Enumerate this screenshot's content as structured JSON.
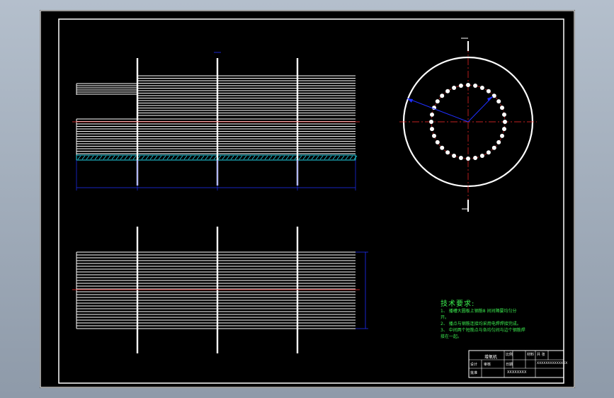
{
  "drawing": {
    "colors": {
      "frame": "#ffffff",
      "centerline": "#ff2a2a",
      "dimension": "#1f2fff",
      "hatch": "#22d4e8",
      "notes": "#3cf050"
    },
    "icons": [
      "section-arrow-icon"
    ]
  },
  "notes": {
    "title": "技术要求:",
    "lines": [
      "1、 播槽大圆板上钢筋8  间间隔要均匀分",
      "    开。",
      "2、 播点与钢筋连接均采用电焊焊接完成。",
      "3、 中间两个短筋点与各均匀间与边个钢筋焊",
      "    接在一起。"
    ]
  },
  "title_block": {
    "drawing_name": "增氧机",
    "designer": "设计",
    "checker": "审核",
    "date_label": "日期",
    "scale_label": "比例",
    "material_label": "材料",
    "sheet_label": "共 张",
    "company": "XXXXXXXXXXXXXX",
    "approver": "批准",
    "school": "XXXXXXXX"
  }
}
